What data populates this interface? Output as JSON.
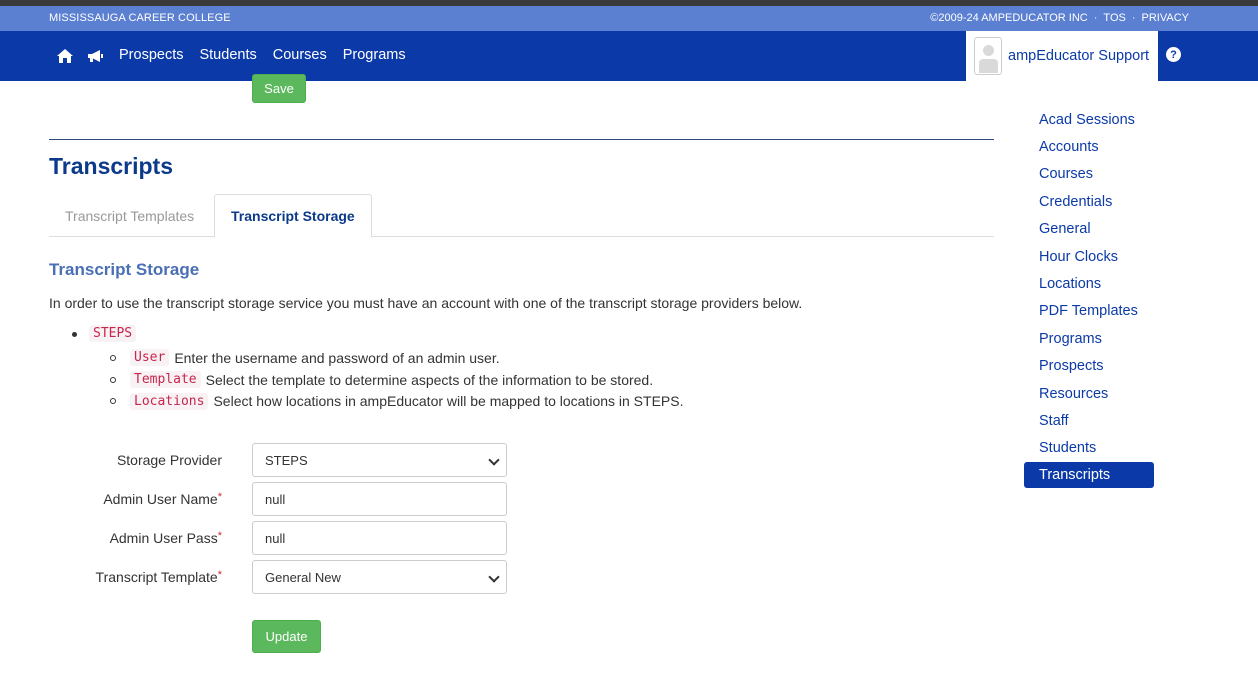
{
  "header": {
    "college_name": "MISSISSAUGA CAREER COLLEGE",
    "copyright": "©2009-24 AMPEDUCATOR INC",
    "tos": "TOS",
    "privacy": "PRIVACY",
    "separator": "·"
  },
  "nav": {
    "icons": [
      "home-icon",
      "megaphone-icon"
    ],
    "links": [
      "Prospects",
      "Students",
      "Courses",
      "Programs"
    ],
    "user_name": "ampEducator Support",
    "help_icon": "?"
  },
  "toolbar": {
    "save_label": "Save"
  },
  "page": {
    "title": "Transcripts",
    "tabs": [
      {
        "label": "Transcript Templates",
        "active": false
      },
      {
        "label": "Transcript Storage",
        "active": true
      }
    ],
    "section_title": "Transcript Storage",
    "intro": "In order to use the transcript storage service you must have an account with one of the transcript storage providers below.",
    "providers": [
      {
        "name": "STEPS",
        "items": [
          {
            "code": "User",
            "text": "Enter the username and password of an admin user."
          },
          {
            "code": "Template",
            "text": "Select the template to determine aspects of the information to be stored."
          },
          {
            "code": "Locations",
            "text": "Select how locations in ampEducator will be mapped to locations in STEPS."
          }
        ]
      }
    ]
  },
  "form": {
    "storage_provider": {
      "label": "Storage Provider",
      "value": "STEPS",
      "required": false
    },
    "admin_user_name": {
      "label": "Admin User Name",
      "value": "null",
      "required": true
    },
    "admin_user_pass": {
      "label": "Admin User Pass",
      "value": "null",
      "required": true
    },
    "transcript_template": {
      "label": "Transcript Template",
      "value": "General New",
      "required": true
    },
    "required_marker": "*",
    "update_label": "Update"
  },
  "sidebar": {
    "items": [
      {
        "label": "Acad Sessions",
        "active": false
      },
      {
        "label": "Accounts",
        "active": false
      },
      {
        "label": "Courses",
        "active": false
      },
      {
        "label": "Credentials",
        "active": false
      },
      {
        "label": "General",
        "active": false
      },
      {
        "label": "Hour Clocks",
        "active": false
      },
      {
        "label": "Locations",
        "active": false
      },
      {
        "label": "PDF Templates",
        "active": false
      },
      {
        "label": "Programs",
        "active": false
      },
      {
        "label": "Prospects",
        "active": false
      },
      {
        "label": "Resources",
        "active": false
      },
      {
        "label": "Staff",
        "active": false
      },
      {
        "label": "Students",
        "active": false
      },
      {
        "label": "Transcripts",
        "active": true
      }
    ]
  },
  "colors": {
    "topbar": "#5b7fd1",
    "navbar": "#0b3aa8",
    "success": "#5cb85c",
    "code": "#c7254e"
  }
}
